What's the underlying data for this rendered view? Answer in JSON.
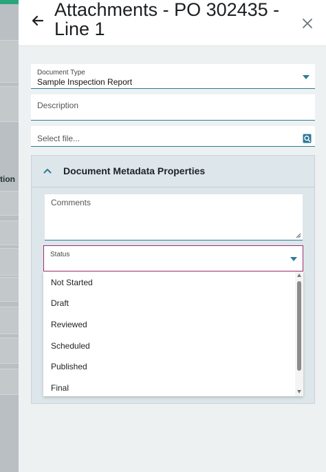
{
  "header": {
    "title": "Attachments - PO 302435 - Line 1",
    "back_icon": "arrow-left-icon",
    "close_icon": "close-icon"
  },
  "background": {
    "partial_label": "tion"
  },
  "form": {
    "document_type": {
      "label": "Document Type",
      "value": "Sample Inspection Report"
    },
    "description": {
      "placeholder": "Description"
    },
    "file": {
      "placeholder": "Select file..."
    }
  },
  "metadata": {
    "title": "Document Metadata Properties",
    "expanded": true,
    "comments": {
      "placeholder": "Comments"
    },
    "status": {
      "label": "Status",
      "options": [
        "Not Started",
        "Draft",
        "Reviewed",
        "Scheduled",
        "Published",
        "Final"
      ]
    }
  },
  "colors": {
    "accent": "#2b7a99",
    "focus_border": "#a02a6e",
    "section_bg": "#dde6ea"
  }
}
